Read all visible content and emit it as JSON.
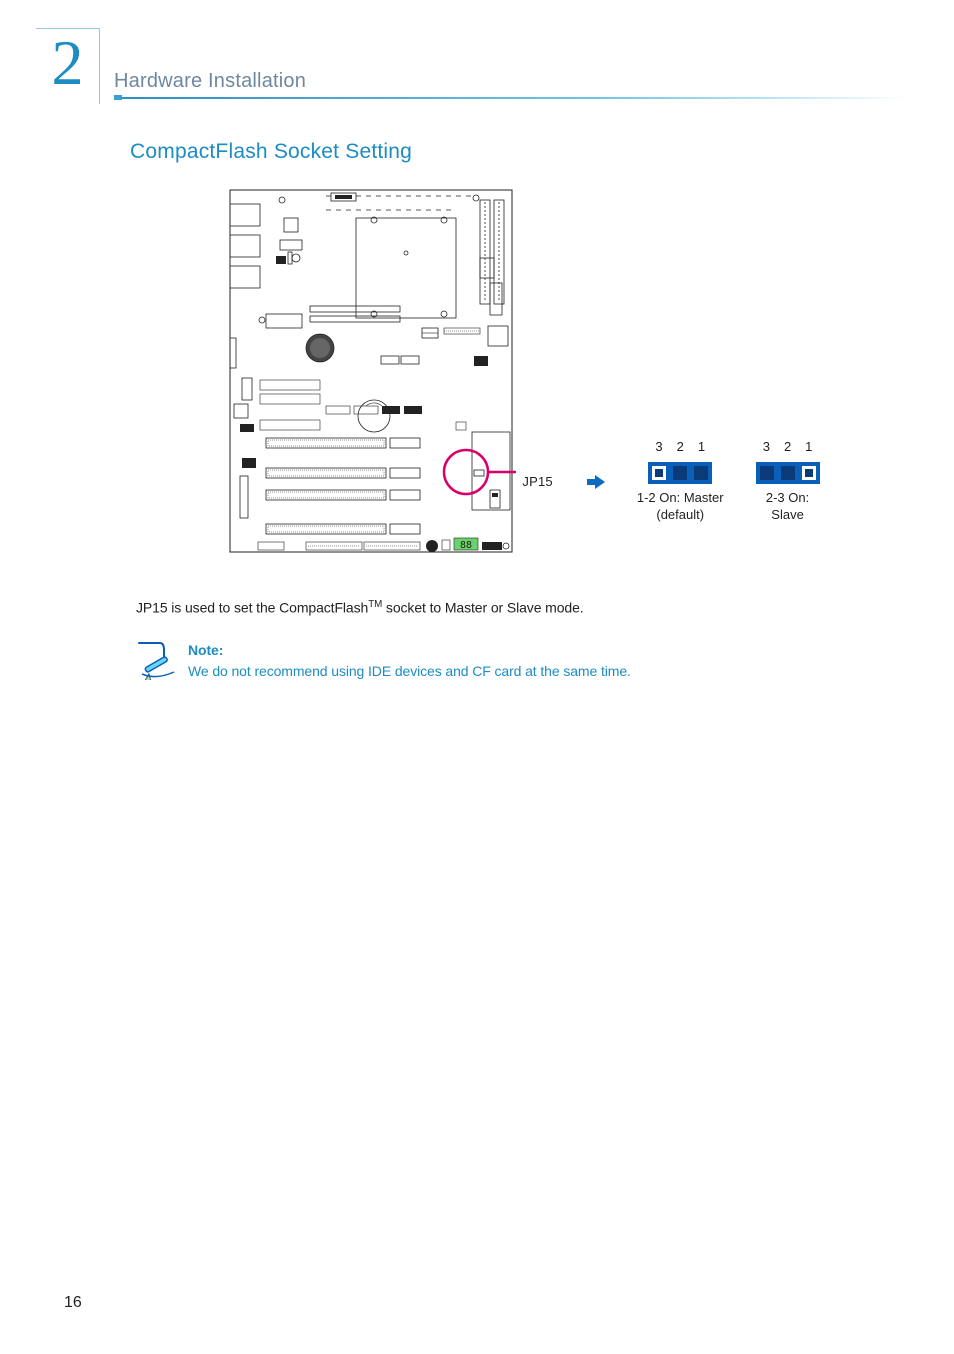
{
  "chapter_number": "2",
  "header_title": "Hardware Installation",
  "section_title": "CompactFlash Socket Setting",
  "figure": {
    "jumper_ref": "JP15",
    "option_a": {
      "pins": [
        "3",
        "2",
        "1"
      ],
      "desc_line1": "1-2 On: Master",
      "desc_line2": "(default)"
    },
    "option_b": {
      "pins": [
        "3",
        "2",
        "1"
      ],
      "desc_line1": "2-3 On:",
      "desc_line2": "Slave"
    }
  },
  "body_prefix": "JP15 is used to set the CompactFlash",
  "body_suffix": " socket to Master or Slave mode.",
  "tm_mark": "TM",
  "note": {
    "label": "Note:",
    "body": "We do not recommend using IDE devices and CF card at the same time."
  },
  "page_number": "16"
}
